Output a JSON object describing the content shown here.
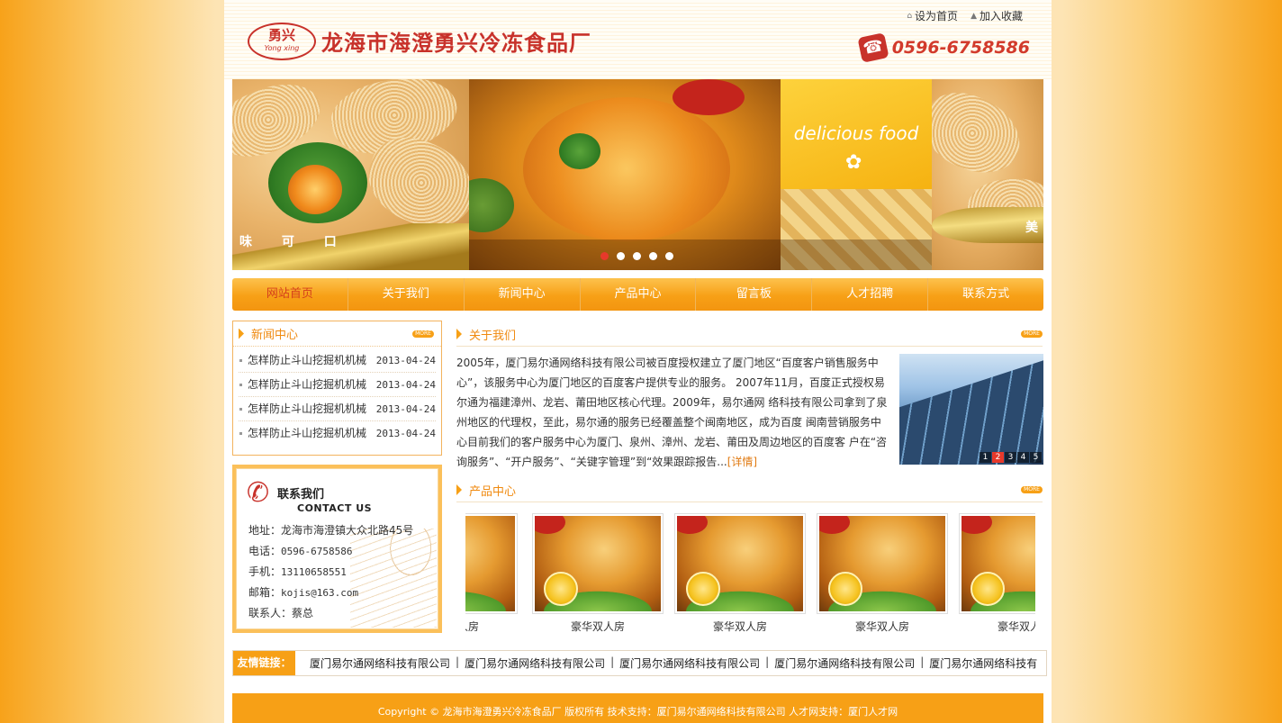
{
  "header": {
    "logo_cn": "勇兴",
    "logo_en": "Yong xing",
    "company_name": "龙海市海澄勇兴冷冻食品厂",
    "set_home": "设为首页",
    "add_favorite": "加入收藏",
    "phone": "0596-6758586"
  },
  "banner": {
    "panel_text_left": "味 可 口",
    "panel_text_right": "美",
    "delicious": "delicious  food",
    "active_dot": 1,
    "dot_count": 5
  },
  "nav": {
    "items": [
      {
        "label": "网站首页",
        "active": true
      },
      {
        "label": "关于我们",
        "active": false
      },
      {
        "label": "新闻中心",
        "active": false
      },
      {
        "label": "产品中心",
        "active": false
      },
      {
        "label": "留言板",
        "active": false
      },
      {
        "label": "人才招聘",
        "active": false
      },
      {
        "label": "联系方式",
        "active": false
      }
    ]
  },
  "news": {
    "title": "新闻中心",
    "more": "MORE",
    "items": [
      {
        "title": "怎样防止斗山挖掘机机械",
        "date": "2013-04-24"
      },
      {
        "title": "怎样防止斗山挖掘机机械",
        "date": "2013-04-24"
      },
      {
        "title": "怎样防止斗山挖掘机机械",
        "date": "2013-04-24"
      },
      {
        "title": "怎样防止斗山挖掘机机械",
        "date": "2013-04-24"
      }
    ]
  },
  "contact": {
    "title_cn": "联系我们",
    "title_en": "CONTACT US",
    "address": "地址：龙海市海澄镇大众北路45号",
    "tel_label": "电话：",
    "tel": "0596-6758586",
    "mobile_label": "手机：",
    "mobile": "13110658551",
    "email_label": "邮箱：",
    "email": "kojis@163.com",
    "person": "联系人：蔡总"
  },
  "about": {
    "title": "关于我们",
    "more": "MORE",
    "text": "2005年，厦门易尔通网络科技有限公司被百度授权建立了厦门地区“百度客户销售服务中心”，该服务中心为厦门地区的百度客户提供专业的服务。 2007年11月，百度正式授权易尔通为福建漳州、龙岩、莆田地区核心代理。2009年，易尔通网 络科技有限公司拿到了泉州地区的代理权，至此，易尔通的服务已经覆盖整个闽南地区，成为百度 闽南营销服务中心目前我们的客户服务中心为厦门、泉州、漳州、龙岩、莆田及周边地区的百度客 户在“咨询服务”、“开户服务”、“关键字管理”到“效果跟踪报告...",
    "detail": "[详情]",
    "pager": [
      "1",
      "2",
      "3",
      "4",
      "5"
    ],
    "pager_current": 2
  },
  "products": {
    "title": "产品中心",
    "more": "MORE",
    "items": [
      {
        "name": "豪华双人房"
      },
      {
        "name": "豪华双人房"
      },
      {
        "name": "豪华双人房"
      },
      {
        "name": "豪华双人房"
      },
      {
        "name": "豪华双人房"
      }
    ]
  },
  "friend_links": {
    "label": "友情链接：",
    "items": [
      "厦门易尔通网络科技有限公司",
      "厦门易尔通网络科技有限公司",
      "厦门易尔通网络科技有限公司",
      "厦门易尔通网络科技有限公司",
      "厦门易尔通网络科技有"
    ]
  },
  "footer": {
    "copyright": "Copyright © 龙海市海澄勇兴冷冻食品厂 版权所有 技术支持：厦门易尔通网络科技有限公司 人才网支持：厦门人才网"
  }
}
